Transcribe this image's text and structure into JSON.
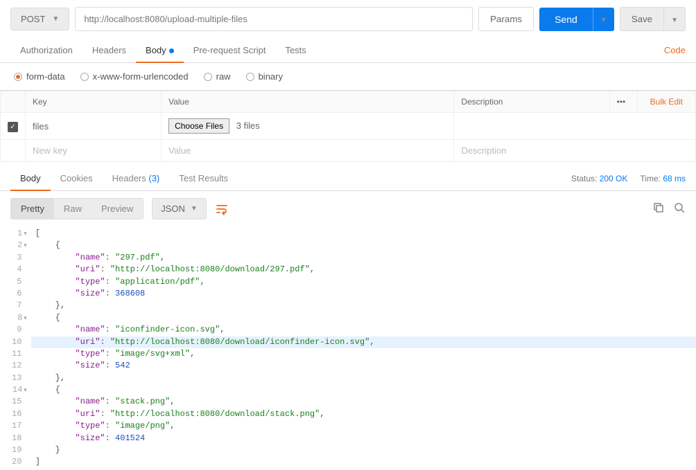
{
  "topbar": {
    "method": "POST",
    "url": "http://localhost:8080/upload-multiple-files",
    "params_label": "Params",
    "send_label": "Send",
    "save_label": "Save"
  },
  "req_tabs": {
    "authorization": "Authorization",
    "headers": "Headers",
    "body": "Body",
    "prerequest": "Pre-request Script",
    "tests": "Tests",
    "code_link": "Code"
  },
  "body_types": {
    "form_data": "form-data",
    "urlencoded": "x-www-form-urlencoded",
    "raw": "raw",
    "binary": "binary"
  },
  "table": {
    "key_header": "Key",
    "value_header": "Value",
    "desc_header": "Description",
    "bulk_edit": "Bulk Edit",
    "kebab": "•••",
    "row_key": "files",
    "choose_files": "Choose Files",
    "file_count": "3 files",
    "new_key_ph": "New key",
    "value_ph": "Value",
    "desc_ph": "Description"
  },
  "resp_tabs": {
    "body": "Body",
    "cookies": "Cookies",
    "headers": "Headers",
    "headers_count": "(3)",
    "test_results": "Test Results"
  },
  "resp_meta": {
    "status_label": "Status:",
    "status_value": "200 OK",
    "time_label": "Time:",
    "time_value": "68 ms"
  },
  "viewer": {
    "pretty": "Pretty",
    "raw": "Raw",
    "preview": "Preview",
    "lang": "JSON"
  },
  "code_lines": [
    {
      "n": 1,
      "fold": true,
      "indent": 0,
      "tokens": [
        {
          "t": "[",
          "c": "p"
        }
      ]
    },
    {
      "n": 2,
      "fold": true,
      "indent": 1,
      "tokens": [
        {
          "t": "{",
          "c": "p"
        }
      ]
    },
    {
      "n": 3,
      "indent": 2,
      "tokens": [
        {
          "t": "\"name\"",
          "c": "k"
        },
        {
          "t": ": ",
          "c": "p"
        },
        {
          "t": "\"297.pdf\"",
          "c": "s"
        },
        {
          "t": ",",
          "c": "p"
        }
      ]
    },
    {
      "n": 4,
      "indent": 2,
      "tokens": [
        {
          "t": "\"uri\"",
          "c": "k"
        },
        {
          "t": ": ",
          "c": "p"
        },
        {
          "t": "\"http://localhost:8080/download/297.pdf\"",
          "c": "s"
        },
        {
          "t": ",",
          "c": "p"
        }
      ]
    },
    {
      "n": 5,
      "indent": 2,
      "tokens": [
        {
          "t": "\"type\"",
          "c": "k"
        },
        {
          "t": ": ",
          "c": "p"
        },
        {
          "t": "\"application/pdf\"",
          "c": "s"
        },
        {
          "t": ",",
          "c": "p"
        }
      ]
    },
    {
      "n": 6,
      "indent": 2,
      "tokens": [
        {
          "t": "\"size\"",
          "c": "k"
        },
        {
          "t": ": ",
          "c": "p"
        },
        {
          "t": "368608",
          "c": "n"
        }
      ]
    },
    {
      "n": 7,
      "indent": 1,
      "tokens": [
        {
          "t": "},",
          "c": "p"
        }
      ]
    },
    {
      "n": 8,
      "fold": true,
      "indent": 1,
      "tokens": [
        {
          "t": "{",
          "c": "p"
        }
      ]
    },
    {
      "n": 9,
      "indent": 2,
      "tokens": [
        {
          "t": "\"name\"",
          "c": "k"
        },
        {
          "t": ": ",
          "c": "p"
        },
        {
          "t": "\"iconfinder-icon.svg\"",
          "c": "s"
        },
        {
          "t": ",",
          "c": "p"
        }
      ]
    },
    {
      "n": 10,
      "hl": true,
      "indent": 2,
      "tokens": [
        {
          "t": "\"uri\"",
          "c": "k"
        },
        {
          "t": ": ",
          "c": "p"
        },
        {
          "t": "\"http://localhost:8080/download/iconfinder-icon.svg\"",
          "c": "s"
        },
        {
          "t": ",",
          "c": "p"
        }
      ]
    },
    {
      "n": 11,
      "indent": 2,
      "tokens": [
        {
          "t": "\"type\"",
          "c": "k"
        },
        {
          "t": ": ",
          "c": "p"
        },
        {
          "t": "\"image/svg+xml\"",
          "c": "s"
        },
        {
          "t": ",",
          "c": "p"
        }
      ]
    },
    {
      "n": 12,
      "indent": 2,
      "tokens": [
        {
          "t": "\"size\"",
          "c": "k"
        },
        {
          "t": ": ",
          "c": "p"
        },
        {
          "t": "542",
          "c": "n"
        }
      ]
    },
    {
      "n": 13,
      "indent": 1,
      "tokens": [
        {
          "t": "},",
          "c": "p"
        }
      ]
    },
    {
      "n": 14,
      "fold": true,
      "indent": 1,
      "tokens": [
        {
          "t": "{",
          "c": "p"
        }
      ]
    },
    {
      "n": 15,
      "indent": 2,
      "tokens": [
        {
          "t": "\"name\"",
          "c": "k"
        },
        {
          "t": ": ",
          "c": "p"
        },
        {
          "t": "\"stack.png\"",
          "c": "s"
        },
        {
          "t": ",",
          "c": "p"
        }
      ]
    },
    {
      "n": 16,
      "indent": 2,
      "tokens": [
        {
          "t": "\"uri\"",
          "c": "k"
        },
        {
          "t": ": ",
          "c": "p"
        },
        {
          "t": "\"http://localhost:8080/download/stack.png\"",
          "c": "s"
        },
        {
          "t": ",",
          "c": "p"
        }
      ]
    },
    {
      "n": 17,
      "indent": 2,
      "tokens": [
        {
          "t": "\"type\"",
          "c": "k"
        },
        {
          "t": ": ",
          "c": "p"
        },
        {
          "t": "\"image/png\"",
          "c": "s"
        },
        {
          "t": ",",
          "c": "p"
        }
      ]
    },
    {
      "n": 18,
      "indent": 2,
      "tokens": [
        {
          "t": "\"size\"",
          "c": "k"
        },
        {
          "t": ": ",
          "c": "p"
        },
        {
          "t": "401524",
          "c": "n"
        }
      ]
    },
    {
      "n": 19,
      "indent": 1,
      "tokens": [
        {
          "t": "}",
          "c": "p"
        }
      ]
    },
    {
      "n": 20,
      "indent": 0,
      "tokens": [
        {
          "t": "]",
          "c": "p"
        }
      ]
    }
  ]
}
